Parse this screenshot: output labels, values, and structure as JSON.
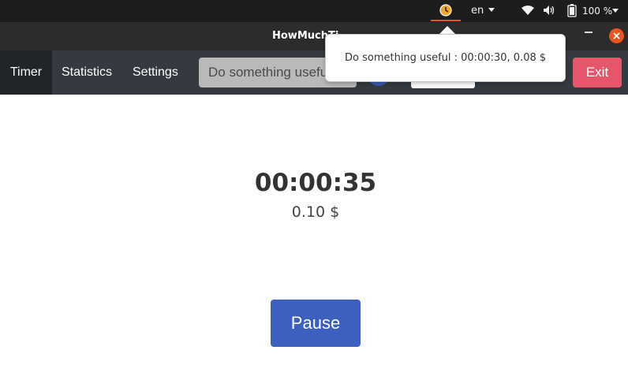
{
  "system_bar": {
    "clock_icon": "clock-icon",
    "language": "en",
    "wifi_icon": "wifi-icon",
    "volume_icon": "volume-icon",
    "battery_icon": "battery-icon",
    "battery_percent": "100 %",
    "accent_color": "#e95420"
  },
  "window": {
    "title": "HowMuchTi"
  },
  "nav": {
    "timer": "Timer",
    "statistics": "Statistics",
    "settings": "Settings",
    "task_value": "Do something useful",
    "exit": "Exit"
  },
  "notification": {
    "text": "Do something useful : 00:00:30, 0.08 $"
  },
  "timer": {
    "elapsed": "00:00:35",
    "cost": "0.10 $",
    "pause_label": "Pause"
  },
  "colors": {
    "navbar": "#343a40",
    "active_tab": "#212529",
    "exit": "#e5566b",
    "pause": "#3d5fbf"
  }
}
